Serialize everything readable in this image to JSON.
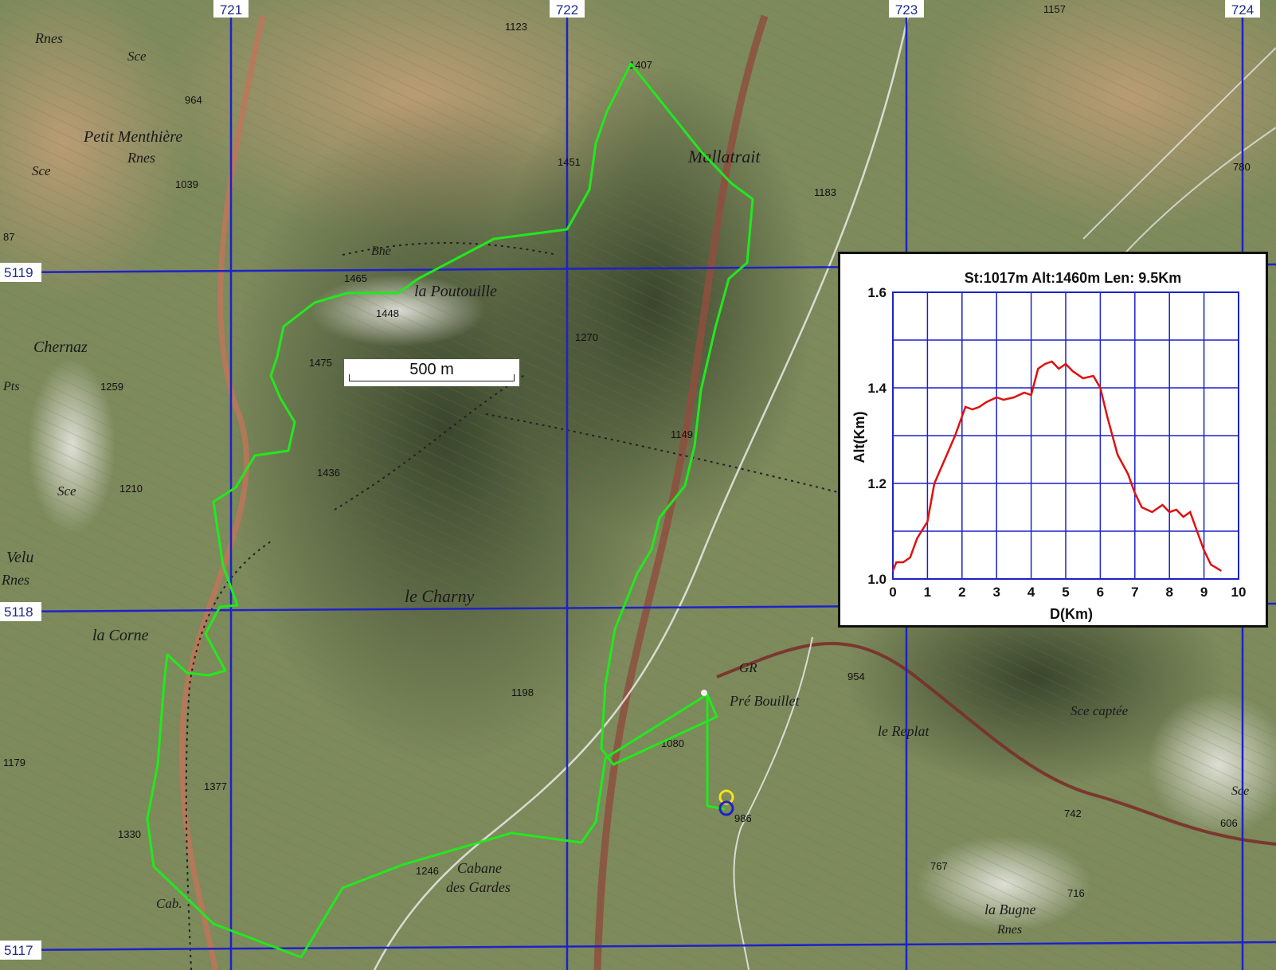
{
  "map": {
    "grid_top_labels": [
      "721",
      "722",
      "723",
      "724"
    ],
    "grid_side_labels": [
      "5119",
      "5118",
      "5117"
    ],
    "place_labels": [
      "Rnes",
      "Sce",
      "Petit Menthière",
      "Rnes",
      "Sce",
      "Chernaz",
      "Pts",
      "Sce",
      "Velu",
      "Rnes",
      "la Corne",
      "Cab.",
      "la Poutouille",
      "Bne",
      "le Charny",
      "Cabane",
      "des Gardes",
      "Pré Bouillet",
      "le Replat",
      "Sce captée",
      "la Bugne",
      "Rnes",
      "Sce",
      "GR",
      "Mallatrait"
    ],
    "spot_heights": [
      "964",
      "1039",
      "87",
      "1259",
      "1210",
      "1179",
      "1377",
      "1330",
      "1465",
      "1448",
      "1475",
      "1436",
      "1123",
      "1407",
      "1451",
      "1270",
      "1149",
      "1198",
      "1080",
      "1246",
      "986",
      "954",
      "742",
      "767",
      "716",
      "606",
      "1183",
      "780",
      "1157"
    ],
    "scale_label": "500 m",
    "track_color": "#22e81e",
    "grid_color": "#1d22c8",
    "start_marker_color": "#f5e21b"
  },
  "profile": {
    "stats": "St:1017m   Alt:1460m   Len: 9.5Km",
    "xlabel": "D(Km)",
    "ylabel": "Alt(Km)"
  },
  "chart_data": {
    "type": "line",
    "title": "St:1017m   Alt:1460m   Len: 9.5Km",
    "xlabel": "D(Km)",
    "ylabel": "Alt(Km)",
    "xlim": [
      0,
      10
    ],
    "ylim": [
      1.0,
      1.6
    ],
    "x_ticks": [
      "0",
      "1",
      "2",
      "3",
      "4",
      "5",
      "6",
      "7",
      "8",
      "9",
      "10"
    ],
    "y_ticks": [
      "1.0",
      "1.2",
      "1.4",
      "1.6"
    ],
    "grid": true,
    "line_color": "#e01010",
    "series": [
      {
        "x": [
          0.0,
          0.1,
          0.3,
          0.5,
          0.7,
          1.0,
          1.2,
          1.5,
          1.8,
          2.1,
          2.3,
          2.5,
          2.7,
          3.0,
          3.2,
          3.5,
          3.8,
          4.0,
          4.2,
          4.4,
          4.6,
          4.8,
          5.0,
          5.2,
          5.5,
          5.8,
          6.0,
          6.2,
          6.5,
          6.8,
          7.0,
          7.2,
          7.5,
          7.8,
          8.0,
          8.2,
          8.4,
          8.6,
          8.8,
          9.0,
          9.2,
          9.5
        ],
        "y": [
          1.017,
          1.035,
          1.035,
          1.045,
          1.085,
          1.12,
          1.2,
          1.25,
          1.3,
          1.36,
          1.355,
          1.36,
          1.37,
          1.38,
          1.375,
          1.38,
          1.39,
          1.385,
          1.44,
          1.45,
          1.455,
          1.44,
          1.45,
          1.435,
          1.42,
          1.425,
          1.4,
          1.34,
          1.26,
          1.22,
          1.18,
          1.15,
          1.14,
          1.155,
          1.14,
          1.145,
          1.13,
          1.14,
          1.1,
          1.06,
          1.03,
          1.017
        ]
      }
    ]
  }
}
